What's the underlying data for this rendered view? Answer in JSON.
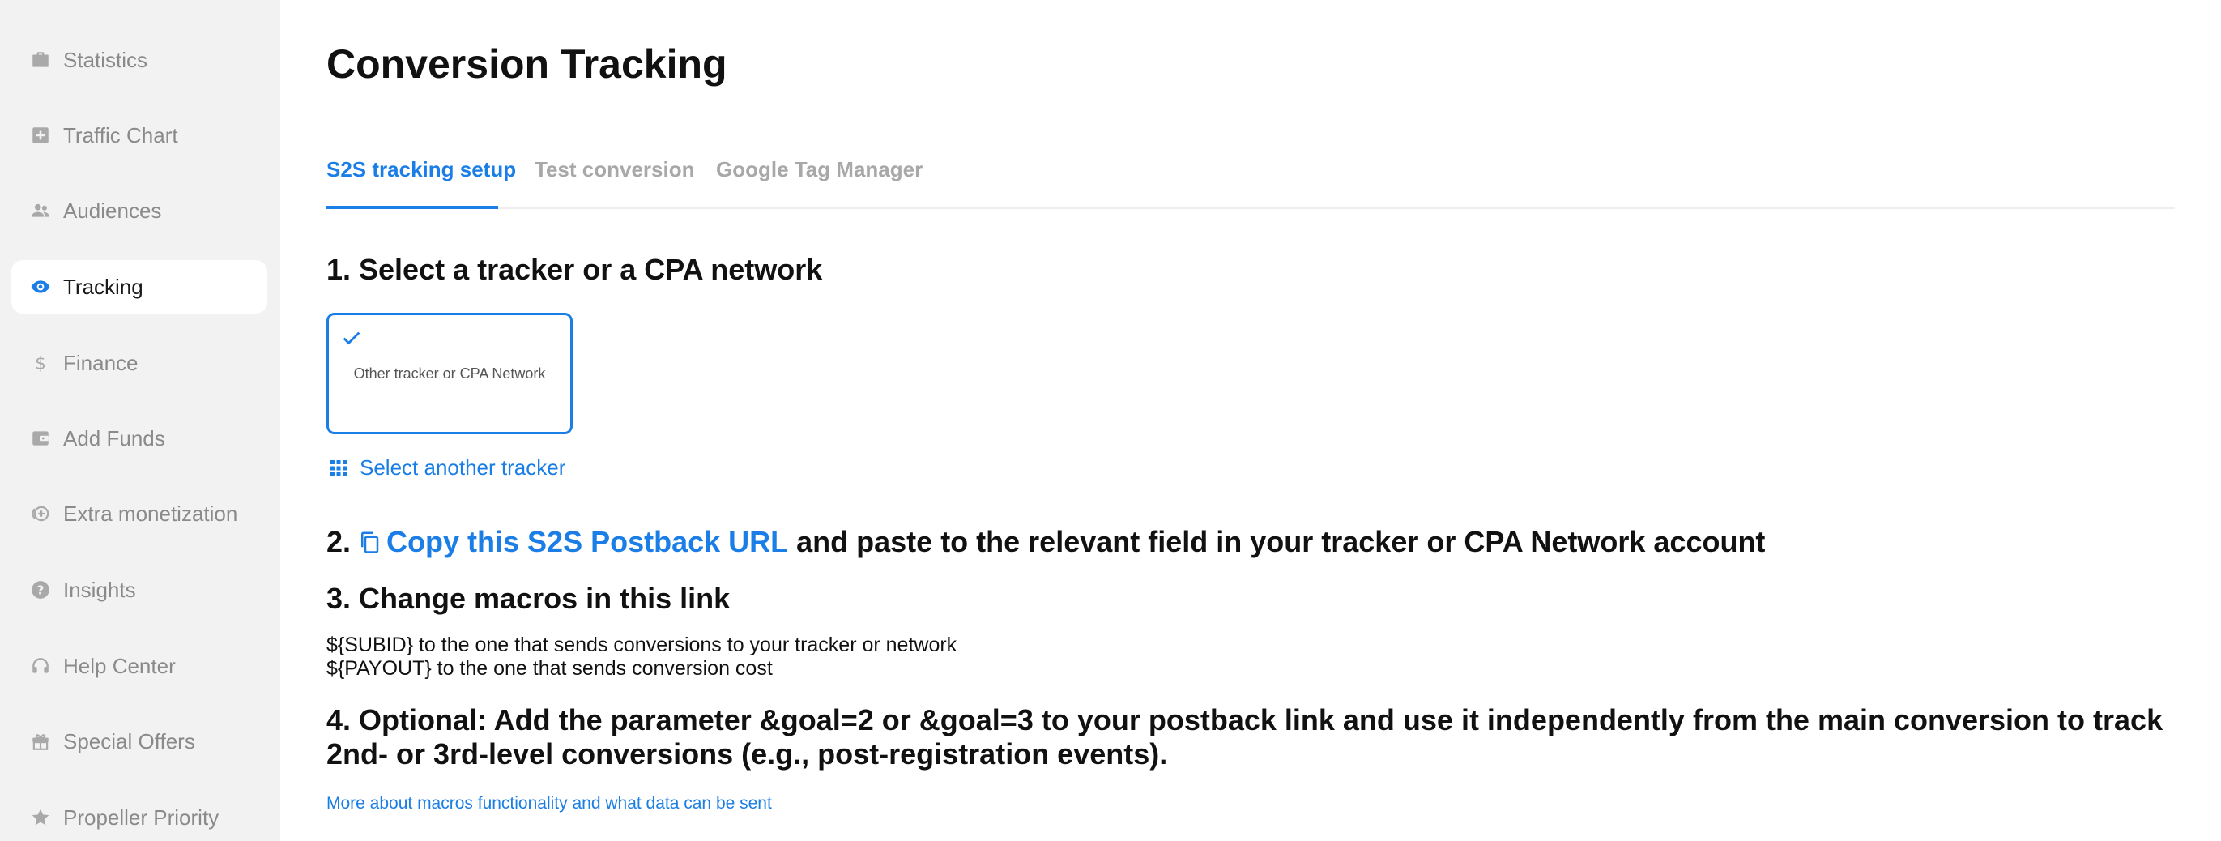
{
  "sidebar": {
    "items": [
      {
        "label": "Statistics",
        "icon": "briefcase-icon"
      },
      {
        "label": "Traffic Chart",
        "icon": "chart-plus-icon"
      },
      {
        "label": "Audiences",
        "icon": "people-icon"
      },
      {
        "label": "Tracking",
        "icon": "eye-icon",
        "active": true
      },
      {
        "label": "Finance",
        "icon": "dollar-icon"
      },
      {
        "label": "Add Funds",
        "icon": "wallet-icon"
      },
      {
        "label": "Extra monetization",
        "icon": "coin-plus-icon"
      },
      {
        "label": "Insights",
        "icon": "help-circle-icon"
      },
      {
        "label": "Help Center",
        "icon": "headset-icon"
      },
      {
        "label": "Special Offers",
        "icon": "gift-icon"
      },
      {
        "label": "Propeller Priority",
        "icon": "star-icon"
      }
    ]
  },
  "page": {
    "title": "Conversion Tracking"
  },
  "tabs": [
    {
      "label": "S2S tracking setup",
      "active": true
    },
    {
      "label": "Test conversion"
    },
    {
      "label": "Google Tag Manager"
    }
  ],
  "step1": {
    "heading": "1. Select a tracker or a CPA network",
    "card_label": "Other tracker or CPA Network",
    "select_another": "Select another tracker"
  },
  "step2": {
    "prefix": "2.",
    "link": "Copy this S2S Postback URL",
    "suffix": "and paste to the relevant field in your tracker or CPA Network account"
  },
  "step3": {
    "heading": "3. Change macros in this link",
    "lines": [
      "${SUBID} to the one that sends conversions to your tracker or network",
      "${PAYOUT} to the one that sends conversion cost"
    ]
  },
  "step4": {
    "heading": "4. Optional: Add the parameter &goal=2 or &goal=3 to your postback link and use it independently from the main conversion to track 2nd- or 3rd-level conversions (e.g., post-registration events)."
  },
  "more_link": "More about macros functionality and what data can be sent",
  "colors": {
    "accent": "#1a7ee6",
    "sidebar_bg": "#f2f2f2",
    "muted_text": "#8a8a8a"
  }
}
